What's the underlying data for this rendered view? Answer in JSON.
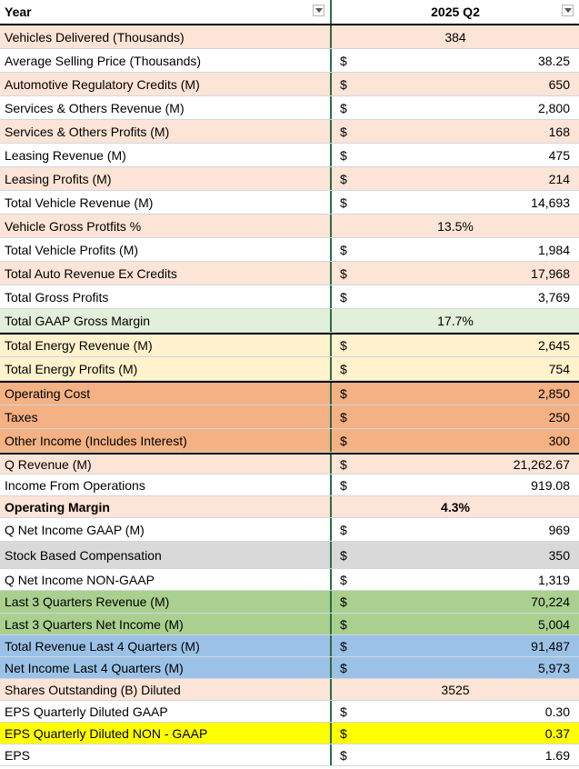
{
  "header": {
    "col1": "Year",
    "col2": "2025 Q2"
  },
  "colors": {
    "peach": "#fce4d6",
    "white": "#ffffff",
    "green_light": "#e2efda",
    "yellow_light": "#fff2cc",
    "orange": "#f4b183",
    "gray": "#d9d9d9",
    "green": "#a9d08e",
    "blue": "#9bc2e6",
    "yellow": "#ffff00"
  },
  "rows": [
    {
      "label": "Vehicles Delivered (Thousands)",
      "dollar": "",
      "value": "384",
      "center": true,
      "bg": "peach",
      "h": 26
    },
    {
      "label": "Average Selling Price (Thousands)",
      "dollar": "$",
      "value": "38.25",
      "bg": "white",
      "h": 26
    },
    {
      "label": "Automotive Regulatory Credits (M)",
      "dollar": "$",
      "value": "650",
      "bg": "peach",
      "h": 26
    },
    {
      "label": "Services & Others Revenue (M)",
      "dollar": "$",
      "value": "2,800",
      "bg": "white",
      "h": 26
    },
    {
      "label": "Services & Others Profits (M)",
      "dollar": "$",
      "value": "168",
      "bg": "peach",
      "h": 26
    },
    {
      "label": "Leasing Revenue (M)",
      "dollar": "$",
      "value": "475",
      "bg": "white",
      "h": 26
    },
    {
      "label": "Leasing Profits (M)",
      "dollar": "$",
      "value": "214",
      "bg": "peach",
      "h": 26
    },
    {
      "label": "Total Vehicle Revenue (M)",
      "dollar": "$",
      "value": "14,693",
      "bg": "white",
      "h": 26
    },
    {
      "label": "Vehicle Gross Protfits %",
      "dollar": "",
      "value": "13.5%",
      "center": true,
      "bg": "peach",
      "h": 26
    },
    {
      "label": "Total Vehicle Profits (M)",
      "dollar": "$",
      "value": "1,984",
      "bg": "white",
      "h": 26
    },
    {
      "label": "Total Auto Revenue Ex Credits",
      "dollar": "$",
      "value": "17,968",
      "bg": "peach",
      "h": 26
    },
    {
      "label": "Total Gross Profits",
      "dollar": "$",
      "value": "3,769",
      "bg": "white",
      "h": 26
    },
    {
      "label": "Total GAAP Gross Margin",
      "dollar": "",
      "value": "17.7%",
      "center": true,
      "bg": "green_light",
      "h": 26
    },
    {
      "label": "Total Energy Revenue (M)",
      "dollar": "$",
      "value": "2,645",
      "bg": "yellow_light",
      "h": 27,
      "thick": true
    },
    {
      "label": "Total Energy Profits (M)",
      "dollar": "$",
      "value": "754",
      "bg": "yellow_light",
      "h": 26
    },
    {
      "label": "Operating Cost",
      "dollar": "$",
      "value": "2,850",
      "bg": "orange",
      "h": 27,
      "thick": true
    },
    {
      "label": "Taxes",
      "dollar": "$",
      "value": "250",
      "bg": "orange",
      "h": 26
    },
    {
      "label": "Other Income (Includes Interest)",
      "dollar": "$",
      "value": "300",
      "bg": "orange",
      "h": 26
    },
    {
      "label": "Q Revenue (M)",
      "dollar": "$",
      "value": "21,262.67",
      "bg": "peach",
      "h": 24,
      "thick": true
    },
    {
      "label": "Income From Operations",
      "dollar": "$",
      "value": "919.08",
      "bg": "white",
      "h": 24
    },
    {
      "label": "Operating Margin",
      "dollar": "",
      "value": "4.3%",
      "center": true,
      "bold": true,
      "bg": "peach",
      "h": 24
    },
    {
      "label": "Q Net Income GAAP (M)",
      "dollar": "$",
      "value": "969",
      "bg": "white",
      "h": 26
    },
    {
      "label": "Stock Based Compensation",
      "dollar": "$",
      "value": "350",
      "bg": "gray",
      "h": 30
    },
    {
      "label": "Q Net Income NON-GAAP",
      "dollar": "$",
      "value": "1,319",
      "bg": "white",
      "h": 24
    },
    {
      "label": "Last 3 Quarters Revenue (M)",
      "dollar": "$",
      "value": "70,224",
      "bg": "green",
      "h": 25
    },
    {
      "label": "Last 3 Quarters Net Income (M)",
      "dollar": "$",
      "value": "5,004",
      "bg": "green",
      "h": 24
    },
    {
      "label": "Total Revenue Last 4 Quarters (M)",
      "dollar": "$",
      "value": "91,487",
      "bg": "blue",
      "h": 24
    },
    {
      "label": "Net Income Last 4 Quarters (M)",
      "dollar": "$",
      "value": "5,973",
      "bg": "blue",
      "h": 24
    },
    {
      "label": "Shares Outstanding (B) Diluted",
      "dollar": "",
      "value": "3525",
      "center": true,
      "bg": "peach",
      "h": 24
    },
    {
      "label": "EPS Quarterly Diluted GAAP",
      "dollar": "$",
      "value": "0.30",
      "bg": "white",
      "h": 24
    },
    {
      "label": "EPS Quarterly Diluted NON - GAAP",
      "dollar": "$",
      "value": "0.37",
      "bg": "yellow",
      "h": 24
    },
    {
      "label": "EPS",
      "dollar": "$",
      "value": "1.69",
      "bg": "white",
      "h": 24
    }
  ]
}
